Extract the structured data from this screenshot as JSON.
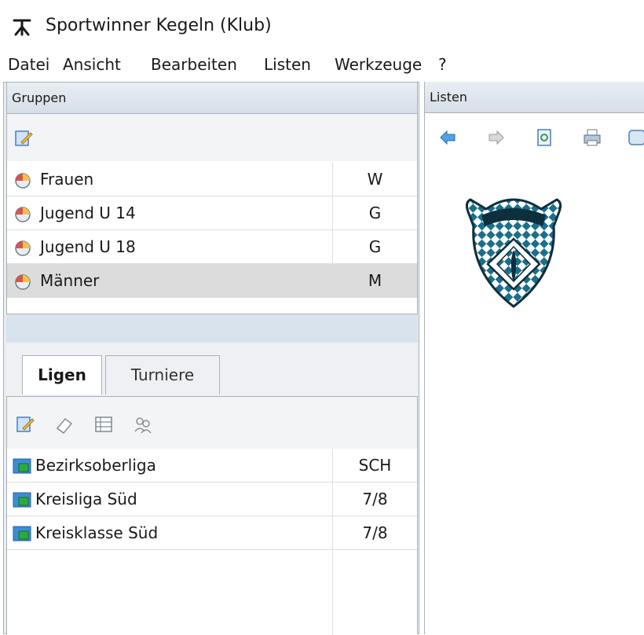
{
  "window": {
    "title": "Sportwinner Kegeln (Klub)",
    "icon": "bowling-pin-icon"
  },
  "menu": [
    "Datei",
    "Ansicht",
    "Bearbeiten",
    "Listen",
    "Werkzeuge",
    "?"
  ],
  "groups": {
    "header": "Gruppen",
    "toolbar_icons": [
      "edit-icon"
    ],
    "rows": [
      {
        "name": "Frauen",
        "code": "W",
        "selected": false
      },
      {
        "name": "Jugend U 14",
        "code": "G",
        "selected": false
      },
      {
        "name": "Jugend U 18",
        "code": "G",
        "selected": false
      },
      {
        "name": "Männer",
        "code": "M",
        "selected": true
      }
    ]
  },
  "tabs": [
    {
      "label": "Ligen",
      "active": true
    },
    {
      "label": "Turniere",
      "active": false
    }
  ],
  "leagues": {
    "toolbar_icons": [
      "edit-icon",
      "eraser-icon",
      "table-icon",
      "users-icon"
    ],
    "rows": [
      {
        "name": "Bezirksoberliga",
        "code": "SCH"
      },
      {
        "name": "Kreisliga Süd",
        "code": "7/8"
      },
      {
        "name": "Kreisklasse Süd",
        "code": "7/8"
      }
    ]
  },
  "lists": {
    "header": "Listen",
    "toolbar_icons": [
      "back-arrow-icon",
      "forward-arrow-icon",
      "preview-icon",
      "print-icon",
      "export-icon"
    ],
    "logo": "club-crest"
  },
  "colors": {
    "header_bg": "#dde4ec",
    "selected_row": "#dcdcdc",
    "crest_blue": "#1a6f8a"
  }
}
